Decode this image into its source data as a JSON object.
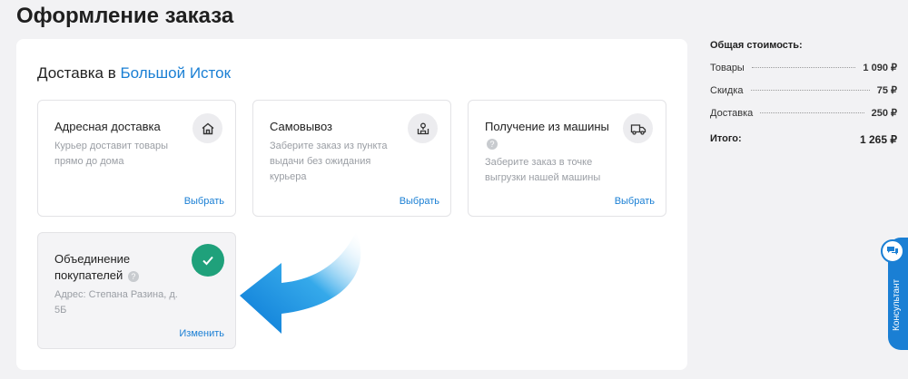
{
  "page": {
    "title": "Оформление заказа"
  },
  "delivery": {
    "heading_prefix": "Доставка в",
    "city": "Большой Исток",
    "options": [
      {
        "title": "Адресная доставка",
        "description": "Курьер доставит товары прямо до дома",
        "action": "Выбрать",
        "icon": "home-icon"
      },
      {
        "title": "Самовывоз",
        "description": "Заберите заказ из пункта выдачи без ожидания курьера",
        "action": "Выбрать",
        "icon": "pickup-point-icon"
      },
      {
        "title": "Получение из машины",
        "help": "?",
        "description": "Заберите заказ в точке выгрузки нашей машины",
        "action": "Выбрать",
        "icon": "truck-icon"
      }
    ],
    "selected_option": {
      "title": "Объединение покупателей",
      "help": "?",
      "description": "Адрес: Степана Разина, д. 5Б",
      "action": "Изменить",
      "icon": "check-icon",
      "accent_color": "#1fa17b"
    }
  },
  "summary": {
    "title": "Общая стоимость:",
    "rows": [
      {
        "label": "Товары",
        "value": "1 090 ₽"
      },
      {
        "label": "Скидка",
        "value": "75 ₽"
      },
      {
        "label": "Доставка",
        "value": "250 ₽"
      }
    ],
    "total_label": "Итого:",
    "total_value": "1 265 ₽"
  },
  "consultant": {
    "label": "Консультант",
    "icon": "chat-icon"
  },
  "colors": {
    "accent": "#1a7fd4",
    "success": "#1fa17b",
    "background": "#f2f2f4"
  }
}
